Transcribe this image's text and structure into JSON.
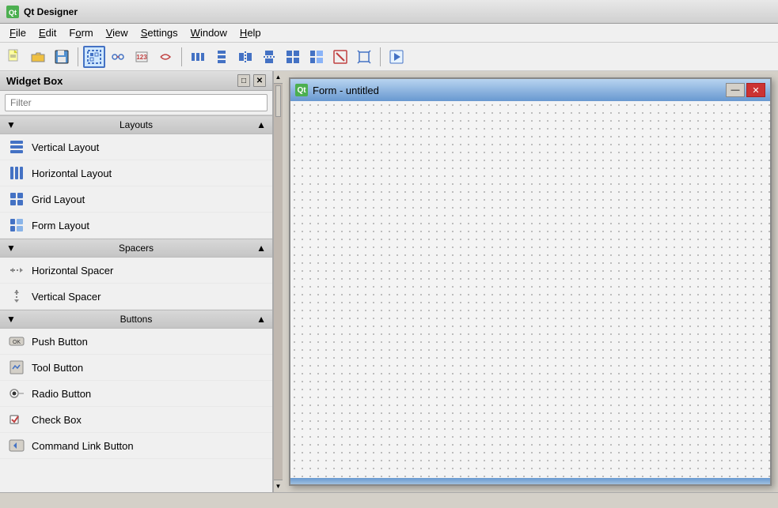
{
  "titleBar": {
    "title": "Qt Designer",
    "iconLabel": "Qt"
  },
  "menuBar": {
    "items": [
      {
        "id": "file",
        "label": "File",
        "underline": "F"
      },
      {
        "id": "edit",
        "label": "Edit",
        "underline": "E"
      },
      {
        "id": "form",
        "label": "Form",
        "underline": "o"
      },
      {
        "id": "view",
        "label": "View",
        "underline": "V"
      },
      {
        "id": "settings",
        "label": "Settings",
        "underline": "S"
      },
      {
        "id": "window",
        "label": "Window",
        "underline": "W"
      },
      {
        "id": "help",
        "label": "Help",
        "underline": "H"
      }
    ]
  },
  "toolbar": {
    "groups": [
      [
        "new",
        "open",
        "save"
      ],
      [
        "form-editor",
        "form-preview",
        "form-pointer",
        "form-connect"
      ],
      [
        "layout-h",
        "layout-v",
        "layout-split-h",
        "layout-split-v",
        "layout-grid",
        "layout-form",
        "layout-break",
        "adjust-size",
        "preview"
      ]
    ]
  },
  "widgetBox": {
    "title": "Widget Box",
    "filterPlaceholder": "Filter",
    "sections": [
      {
        "id": "layouts",
        "label": "Layouts",
        "items": [
          {
            "id": "vertical-layout",
            "label": "Vertical Layout",
            "icon": "vertical-layout"
          },
          {
            "id": "horizontal-layout",
            "label": "Horizontal Layout",
            "icon": "horizontal-layout"
          },
          {
            "id": "grid-layout",
            "label": "Grid Layout",
            "icon": "grid-layout"
          },
          {
            "id": "form-layout",
            "label": "Form Layout",
            "icon": "form-layout"
          }
        ]
      },
      {
        "id": "spacers",
        "label": "Spacers",
        "items": [
          {
            "id": "horizontal-spacer",
            "label": "Horizontal Spacer",
            "icon": "horizontal-spacer"
          },
          {
            "id": "vertical-spacer",
            "label": "Vertical Spacer",
            "icon": "vertical-spacer"
          }
        ]
      },
      {
        "id": "buttons",
        "label": "Buttons",
        "items": [
          {
            "id": "push-button",
            "label": "Push Button",
            "icon": "push-button"
          },
          {
            "id": "tool-button",
            "label": "Tool Button",
            "icon": "tool-button"
          },
          {
            "id": "radio-button",
            "label": "Radio Button",
            "icon": "radio-button"
          },
          {
            "id": "check-box",
            "label": "Check Box",
            "icon": "check-box"
          },
          {
            "id": "command-link",
            "label": "Command Link Button",
            "icon": "command-link"
          }
        ]
      }
    ]
  },
  "formWindow": {
    "title": "Form - untitled"
  },
  "statusBar": {
    "text": ""
  }
}
